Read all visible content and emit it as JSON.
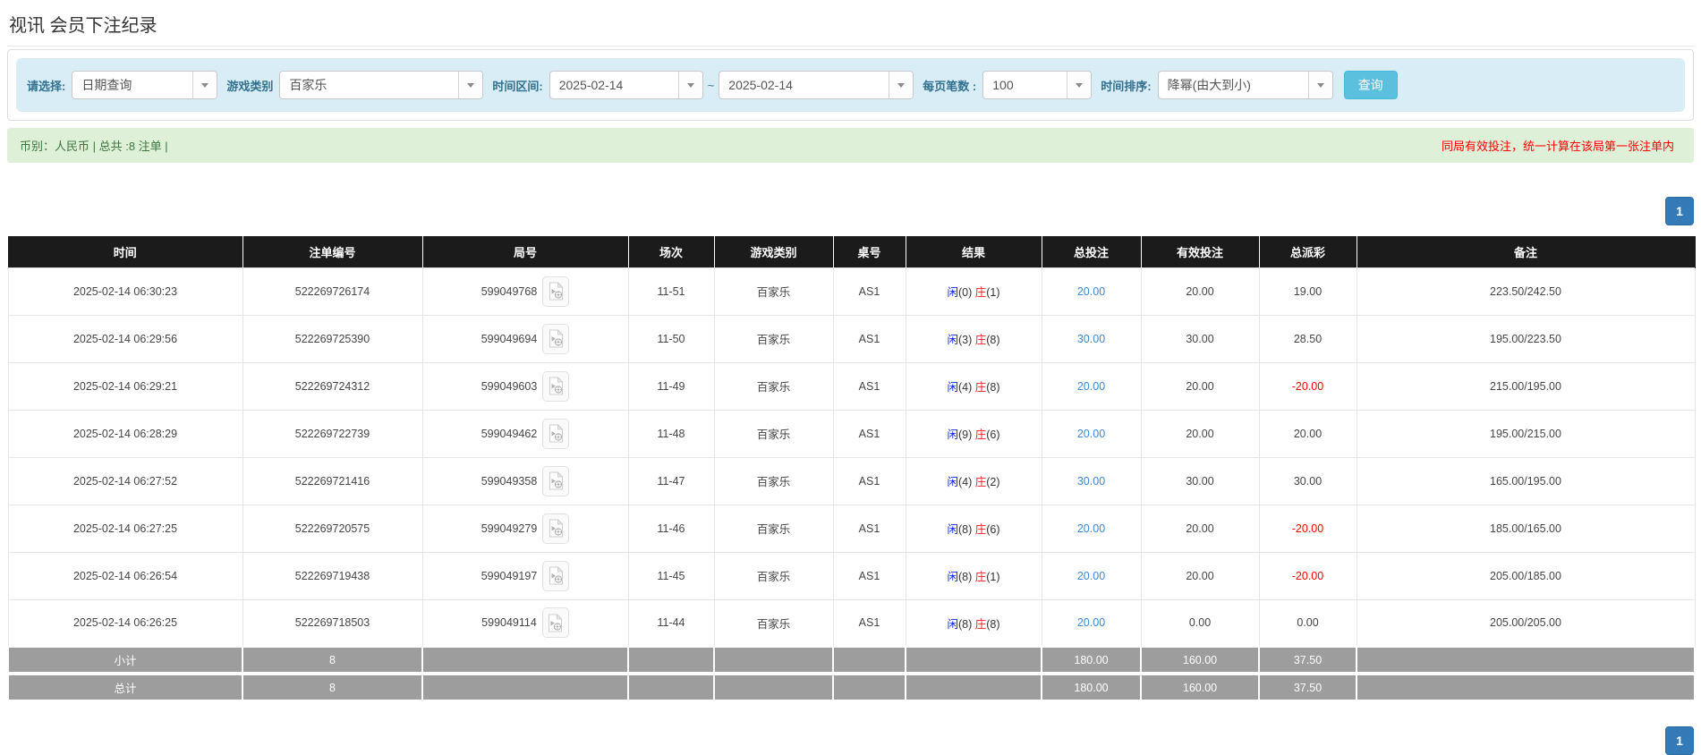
{
  "page": {
    "title": "视讯 会员下注纪录"
  },
  "filter": {
    "select_label": "请选择:",
    "select_value": "日期查询",
    "game_type_label": "游戏类别",
    "game_type_value": "百家乐",
    "time_range_label": "时间区间:",
    "time_from": "2025-02-14",
    "time_separator": "~",
    "time_to": "2025-02-14",
    "page_size_label": "每页笔数 :",
    "page_size_value": "100",
    "sort_label": "时间排序:",
    "sort_value": "降幂(由大到小)",
    "search_button": "查询"
  },
  "summary": {
    "left_text": "币别：人民币 | 总共 :8 注单 |",
    "right_text": "同局有效投注，统一计算在该局第一张注单内"
  },
  "pagination": {
    "current_page": "1"
  },
  "table": {
    "headers": [
      "时间",
      "注单编号",
      "局号",
      "场次",
      "游戏类别",
      "桌号",
      "结果",
      "总投注",
      "有效投注",
      "总派彩",
      "备注"
    ],
    "result_chars": {
      "player": "闲",
      "banker": "庄"
    },
    "rows": [
      {
        "time": "2025-02-14 06:30:23",
        "bet_id": "522269726174",
        "round": "599049768",
        "session": "11-51",
        "game": "百家乐",
        "table_no": "AS1",
        "p": "(0)",
        "b": "(1)",
        "total_bet": "20.00",
        "valid_bet": "20.00",
        "payout": "19.00",
        "remark": "223.50/242.50"
      },
      {
        "time": "2025-02-14 06:29:56",
        "bet_id": "522269725390",
        "round": "599049694",
        "session": "11-50",
        "game": "百家乐",
        "table_no": "AS1",
        "p": "(3)",
        "b": "(8)",
        "total_bet": "30.00",
        "valid_bet": "30.00",
        "payout": "28.50",
        "remark": "195.00/223.50"
      },
      {
        "time": "2025-02-14 06:29:21",
        "bet_id": "522269724312",
        "round": "599049603",
        "session": "11-49",
        "game": "百家乐",
        "table_no": "AS1",
        "p": "(4)",
        "b": "(8)",
        "total_bet": "20.00",
        "valid_bet": "20.00",
        "payout": "-20.00",
        "remark": "215.00/195.00"
      },
      {
        "time": "2025-02-14 06:28:29",
        "bet_id": "522269722739",
        "round": "599049462",
        "session": "11-48",
        "game": "百家乐",
        "table_no": "AS1",
        "p": "(9)",
        "b": "(6)",
        "total_bet": "20.00",
        "valid_bet": "20.00",
        "payout": "20.00",
        "remark": "195.00/215.00"
      },
      {
        "time": "2025-02-14 06:27:52",
        "bet_id": "522269721416",
        "round": "599049358",
        "session": "11-47",
        "game": "百家乐",
        "table_no": "AS1",
        "p": "(4)",
        "b": "(2)",
        "total_bet": "30.00",
        "valid_bet": "30.00",
        "payout": "30.00",
        "remark": "165.00/195.00"
      },
      {
        "time": "2025-02-14 06:27:25",
        "bet_id": "522269720575",
        "round": "599049279",
        "session": "11-46",
        "game": "百家乐",
        "table_no": "AS1",
        "p": "(8)",
        "b": "(6)",
        "total_bet": "20.00",
        "valid_bet": "20.00",
        "payout": "-20.00",
        "remark": "185.00/165.00"
      },
      {
        "time": "2025-02-14 06:26:54",
        "bet_id": "522269719438",
        "round": "599049197",
        "session": "11-45",
        "game": "百家乐",
        "table_no": "AS1",
        "p": "(8)",
        "b": "(1)",
        "total_bet": "20.00",
        "valid_bet": "20.00",
        "payout": "-20.00",
        "remark": "205.00/185.00"
      },
      {
        "time": "2025-02-14 06:26:25",
        "bet_id": "522269718503",
        "round": "599049114",
        "session": "11-44",
        "game": "百家乐",
        "table_no": "AS1",
        "p": "(8)",
        "b": "(8)",
        "total_bet": "20.00",
        "valid_bet": "0.00",
        "payout": "0.00",
        "remark": "205.00/205.00"
      }
    ],
    "subtotal": {
      "label": "小计",
      "count": "8",
      "total_bet": "180.00",
      "valid_bet": "160.00",
      "payout": "37.50"
    },
    "grand_total": {
      "label": "总计",
      "count": "8",
      "total_bet": "180.00",
      "valid_bet": "160.00",
      "payout": "37.50"
    }
  },
  "colors": {
    "filter_bar_bg": "#d9edf7",
    "search_button_bg": "#5bc0de",
    "summary_bg": "#dff0d8",
    "summary_text": "#3c763d",
    "alert_red": "#ff0000",
    "header_bg": "#1b1b1b",
    "pagination_blue": "#337ab7",
    "link_blue": "#3a87db",
    "player_blue": "#0b24fb",
    "banker_red": "#ec1c24",
    "total_row_gray": "#9d9d9d"
  }
}
